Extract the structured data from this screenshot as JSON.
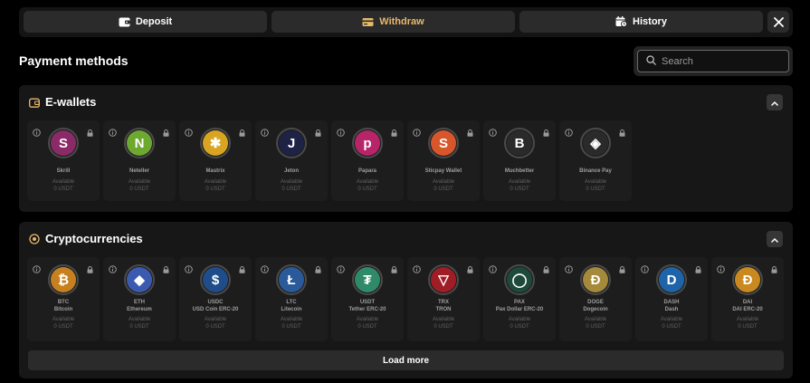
{
  "tabs": {
    "deposit": "Deposit",
    "withdraw": "Withdraw",
    "history": "History",
    "active": "withdraw"
  },
  "colors": {
    "accent": "#e8b86b",
    "background": "#000000",
    "panel": "#171717"
  },
  "payment_methods_title": "Payment methods",
  "search": {
    "placeholder": "Search",
    "value": ""
  },
  "sections": {
    "ewallets": {
      "title": "E-wallets",
      "items": [
        {
          "name": "Skrill",
          "available_label": "Available",
          "amount": "0 USDT",
          "icon": "skrill-logo",
          "color": "#8a2a66",
          "glyph": "S"
        },
        {
          "name": "Neteller",
          "available_label": "Available",
          "amount": "0 USDT",
          "icon": "neteller-logo",
          "color": "#6da82f",
          "glyph": "N"
        },
        {
          "name": "Mastrix",
          "available_label": "Available",
          "amount": "0 USDT",
          "icon": "mastrix-logo",
          "color": "#d9a520",
          "glyph": "✱"
        },
        {
          "name": "Jeton",
          "available_label": "Available",
          "amount": "0 USDT",
          "icon": "jeton-logo",
          "color": "#1e2244",
          "glyph": "J"
        },
        {
          "name": "Papara",
          "available_label": "Available",
          "amount": "0 USDT",
          "icon": "papara-logo",
          "color": "#b8246a",
          "glyph": "p"
        },
        {
          "name": "Sticpay Wallet",
          "available_label": "Available",
          "amount": "0 USDT",
          "icon": "sticpay-logo",
          "color": "#d8562a",
          "glyph": "S"
        },
        {
          "name": "Muchbetter",
          "available_label": "Available",
          "amount": "0 USDT",
          "icon": "muchbetter-logo",
          "color": "#2a2a2a",
          "glyph": "B"
        },
        {
          "name": "Binance Pay",
          "available_label": "Available",
          "amount": "0 USDT",
          "icon": "binance-logo",
          "color": "#2a2a2a",
          "glyph": "◈"
        }
      ]
    },
    "crypto": {
      "title": "Cryptocurrencies",
      "items": [
        {
          "name": "BTC",
          "sub": "Bitcoin",
          "available_label": "Available",
          "amount": "0 USDT",
          "icon": "bitcoin-logo",
          "color": "#c7801f",
          "glyph": "₿"
        },
        {
          "name": "ETH",
          "sub": "Ethereum",
          "available_label": "Available",
          "amount": "0 USDT",
          "icon": "ethereum-logo",
          "color": "#3c5ab0",
          "glyph": "◆"
        },
        {
          "name": "USDC",
          "sub": "USD Coin ERC-20",
          "available_label": "Available",
          "amount": "0 USDT",
          "icon": "usdc-logo",
          "color": "#1f4d8a",
          "glyph": "$"
        },
        {
          "name": "LTC",
          "sub": "Litecoin",
          "available_label": "Available",
          "amount": "0 USDT",
          "icon": "litecoin-logo",
          "color": "#2a5a9a",
          "glyph": "Ł"
        },
        {
          "name": "USDT",
          "sub": "Tether ERC-20",
          "available_label": "Available",
          "amount": "0 USDT",
          "icon": "tether-logo",
          "color": "#2f8a6a",
          "glyph": "₮"
        },
        {
          "name": "TRX",
          "sub": "TRON",
          "available_label": "Available",
          "amount": "0 USDT",
          "icon": "tron-logo",
          "color": "#a11d26",
          "glyph": "▽"
        },
        {
          "name": "PAX",
          "sub": "Pax Dollar ERC-20",
          "available_label": "Available",
          "amount": "0 USDT",
          "icon": "pax-logo",
          "color": "#1d4a3a",
          "glyph": "◯"
        },
        {
          "name": "DOGE",
          "sub": "Dogecoin",
          "available_label": "Available",
          "amount": "0 USDT",
          "icon": "dogecoin-logo",
          "color": "#a48a3a",
          "glyph": "Ð"
        },
        {
          "name": "DASH",
          "sub": "Dash",
          "available_label": "Available",
          "amount": "0 USDT",
          "icon": "dash-logo",
          "color": "#1f63a8",
          "glyph": "D"
        },
        {
          "name": "DAI",
          "sub": "DAI ERC-20",
          "available_label": "Available",
          "amount": "0 USDT",
          "icon": "dai-logo",
          "color": "#c9891f",
          "glyph": "Ð"
        }
      ]
    }
  },
  "load_more": "Load more"
}
